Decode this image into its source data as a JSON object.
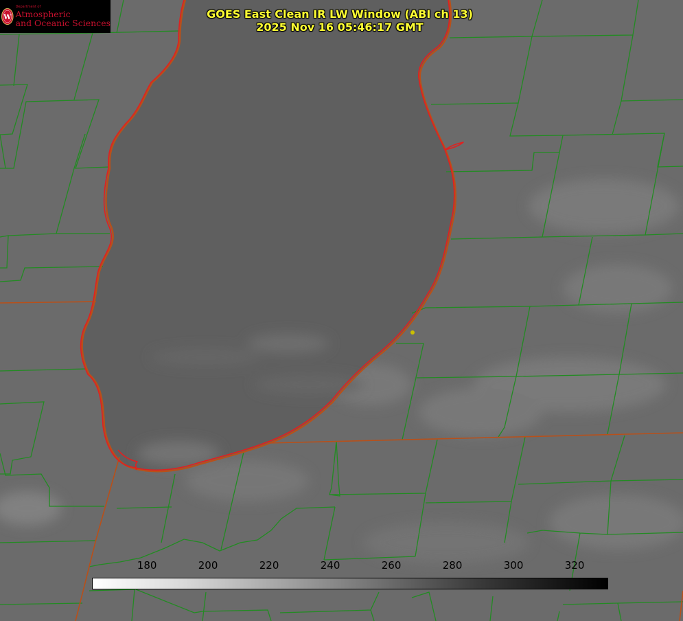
{
  "title": {
    "line1": "GOES East Clean IR LW Window (ABI ch 13)",
    "line2": "2025 Nov 16 05:46:17 GMT"
  },
  "logo": {
    "department": "Department of",
    "line1": "Atmospheric",
    "line2": "and Oceanic Sciences",
    "crest_letter": "W"
  },
  "colorbar": {
    "ticks": [
      "180",
      "200",
      "220",
      "240",
      "260",
      "280",
      "300",
      "320"
    ],
    "min": 162,
    "max": 331
  },
  "colors": {
    "county_lines": "#228b22",
    "state_lines": "#b8501a",
    "lake_outline": "#e02020",
    "marker": "#ccc000",
    "title_text": "#ffff33",
    "logo_text": "#c8102e"
  }
}
